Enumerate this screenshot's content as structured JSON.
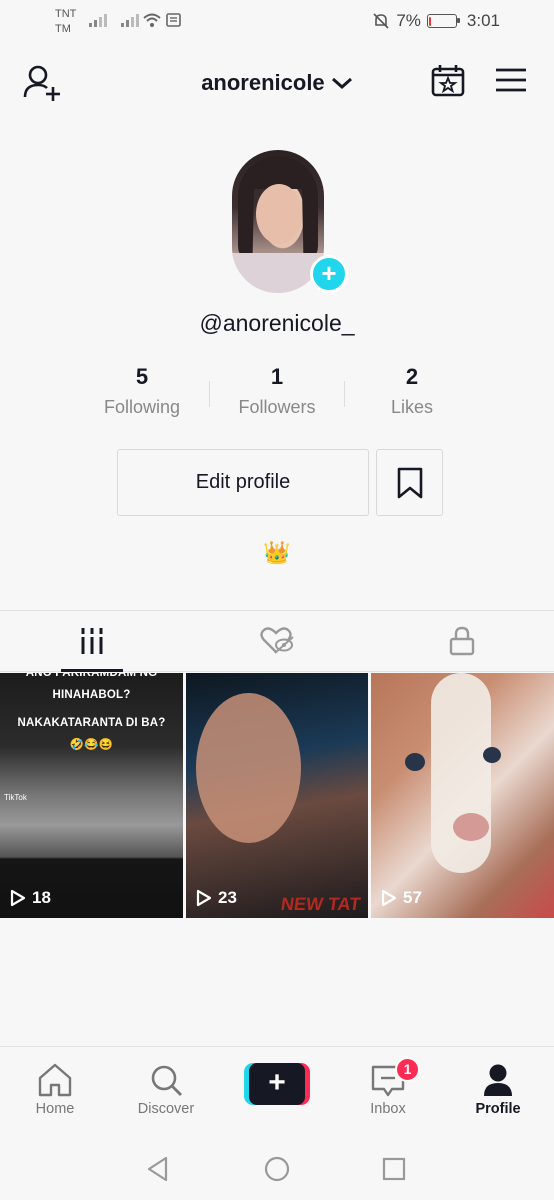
{
  "status": {
    "carrier_line1": "TNT",
    "carrier_line2": "TM",
    "battery_percent": "7%",
    "battery_level": 0.07,
    "time": "3:01"
  },
  "header": {
    "username_title": "anorenicole",
    "add_friend_icon": "add-user-icon",
    "calendar_icon": "calendar-star-icon",
    "menu_icon": "hamburger-icon"
  },
  "profile": {
    "handle": "@anorenicole_",
    "bio": "👑"
  },
  "stats": [
    {
      "value": "5",
      "label": "Following"
    },
    {
      "value": "1",
      "label": "Followers"
    },
    {
      "value": "2",
      "label": "Likes"
    }
  ],
  "actions": {
    "edit_profile": "Edit profile"
  },
  "tabs": [
    {
      "icon": "grid-icon",
      "active": true
    },
    {
      "icon": "liked-hidden-icon",
      "active": false
    },
    {
      "icon": "lock-icon",
      "active": false
    }
  ],
  "videos": [
    {
      "views": "18",
      "caption_line1": "ANO PAKIRAMDAM NG",
      "caption_line2": "HINAHABOL?",
      "caption_line3": "NAKAKATARANTA DI BA?",
      "caption_line4": "🤣😂😆",
      "watermark": "TikTok"
    },
    {
      "views": "23",
      "overlay_text": "NEW TAT"
    },
    {
      "views": "57"
    }
  ],
  "bottom_nav": [
    {
      "label": "Home",
      "icon": "home-icon"
    },
    {
      "label": "Discover",
      "icon": "search-icon"
    },
    {
      "label": "",
      "icon": "create-plus-icon"
    },
    {
      "label": "Inbox",
      "icon": "inbox-icon",
      "badge": "1"
    },
    {
      "label": "Profile",
      "icon": "person-icon",
      "active": true
    }
  ],
  "colors": {
    "accent_cyan": "#20d5ec",
    "accent_red": "#fe2c55",
    "text_dark": "#161823"
  }
}
